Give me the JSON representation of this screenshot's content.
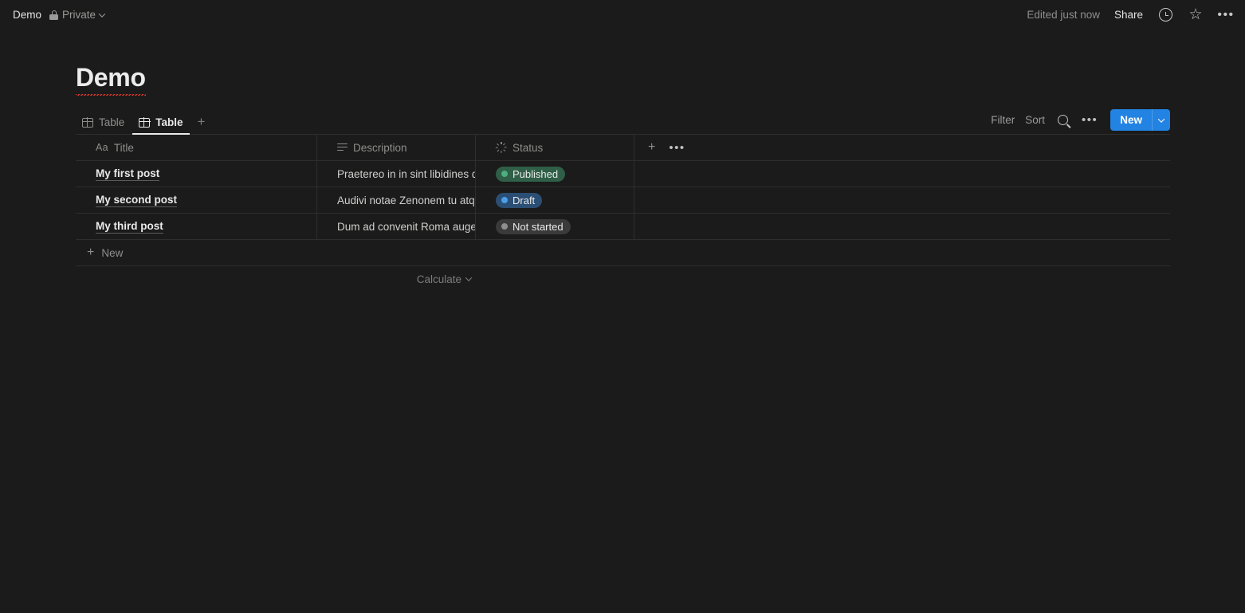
{
  "topbar": {
    "breadcrumb": "Demo",
    "privacy_label": "Private",
    "edited_status": "Edited just now",
    "share_label": "Share",
    "icons": {
      "lock": "lock-icon",
      "chevron": "chevron-down-icon",
      "history": "clock-icon",
      "favorite": "star-icon",
      "more": "more-horizontal-icon"
    }
  },
  "page": {
    "title": "Demo"
  },
  "views": {
    "tabs": [
      {
        "label": "Table",
        "icon": "table-icon",
        "active": false
      },
      {
        "label": "Table",
        "icon": "table-icon",
        "active": true
      }
    ],
    "add_view_label": "+"
  },
  "toolbar": {
    "filter_label": "Filter",
    "sort_label": "Sort",
    "search_icon": "search-icon",
    "more_icon": "more-horizontal-icon",
    "new_label": "New",
    "new_dropdown_icon": "chevron-down-icon",
    "accent_color": "#2383e2"
  },
  "table": {
    "columns": [
      {
        "name": "Title",
        "icon": "text-aa-icon"
      },
      {
        "name": "Description",
        "icon": "rich-text-lines-icon"
      },
      {
        "name": "Status",
        "icon": "status-spinner-icon"
      }
    ],
    "add_column_label": "+",
    "column_options_label": "•••",
    "rows": [
      {
        "title": "My first post",
        "description": "Praetereo in in sint libidines quo",
        "status": {
          "label": "Published",
          "bg": "#2f5f47",
          "dot": "#4caf7d"
        }
      },
      {
        "title": "My second post",
        "description": "Audivi notae Zenonem tu atque",
        "status": {
          "label": "Draft",
          "bg": "#2b4f74",
          "dot": "#4a9eea"
        }
      },
      {
        "title": "My third post",
        "description": "Dum ad convenit Roma augere",
        "status": {
          "label": "Not started",
          "bg": "#3a3a3a",
          "dot": "#8e8e8c"
        }
      }
    ],
    "new_row_label": "New",
    "calculate_label": "Calculate"
  }
}
